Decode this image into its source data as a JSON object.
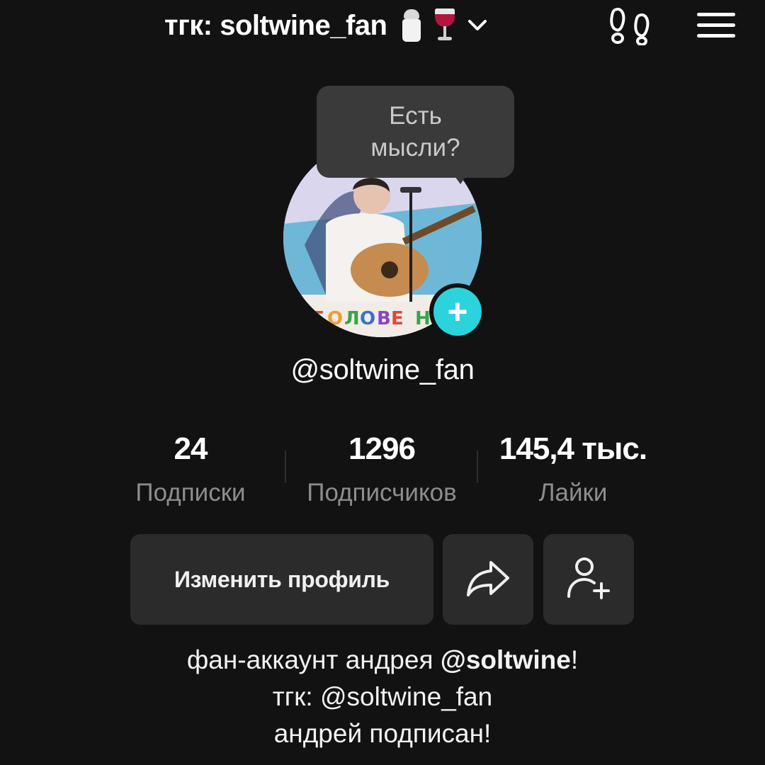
{
  "header": {
    "title": "тгк: soltwine_fan",
    "icons": [
      "salt-shaker-emoji",
      "wine-glass-emoji",
      "chevron-down-icon",
      "footprints-icon",
      "menu-icon"
    ]
  },
  "tooltip": {
    "line1": "Есть",
    "line2": "мысли?"
  },
  "profile": {
    "username": "@soltwine_fan",
    "avatar_caption": "ГОЛОВЕ НЕ"
  },
  "stats": [
    {
      "value": "24",
      "label": "Подписки"
    },
    {
      "value": "1296",
      "label": "Подписчиков"
    },
    {
      "value": "145,4 тыс.",
      "label": "Лайки"
    }
  ],
  "buttons": {
    "edit_profile": "Изменить профиль"
  },
  "bio": {
    "line1_prefix": "фан-аккаунт андрея ",
    "line1_mention": "@soltwine",
    "line1_suffix": "!",
    "line2": "тгк: @soltwine_fan",
    "line3": "андрей подписан!"
  },
  "colors": {
    "background": "#121212",
    "add_button": "#2bd4dd",
    "button_bg": "#2b2b2b",
    "secondary_text": "#8d8d8d"
  }
}
